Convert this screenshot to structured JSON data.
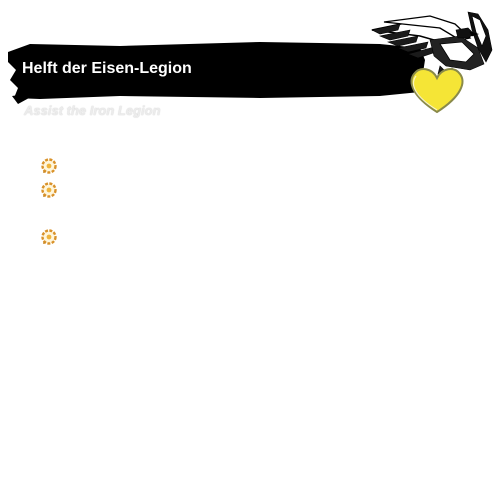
{
  "quest": {
    "title": "Helft der Eisen-Legion",
    "subtitle": "Assist the Iron Legion"
  },
  "emblem": {
    "icon": "eagle-emblem-icon",
    "heart_icon": "heart-icon",
    "heart_color": "#f5e536"
  },
  "objectives": [
    {
      "icon": "objective-marker-icon",
      "text": ""
    },
    {
      "icon": "objective-marker-icon",
      "text": ""
    },
    {
      "icon": "objective-marker-icon",
      "text": ""
    }
  ],
  "colors": {
    "banner": "#000000",
    "title_text": "#ffffff",
    "marker": "#e8a632"
  }
}
